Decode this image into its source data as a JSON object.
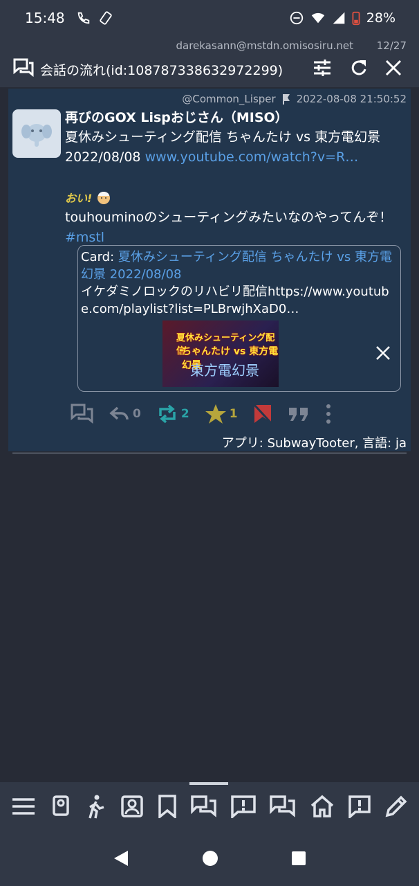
{
  "status_bar": {
    "time": "15:48",
    "battery": "28%"
  },
  "column_header": {
    "account": "darekasann@mstdn.omisosiru.net",
    "position": "12/27",
    "title": "会話の流れ(id:108787338632972299)"
  },
  "post": {
    "acct": "@Common_Lisper",
    "timestamp": "2022-08-08 21:50:52",
    "display_name": "再びのGOX Lispおじさん（MISO）",
    "text_line1": "夏休みシューティング配信 ちゃんたけ vs 東方電幻景 2022/08/08",
    "link": "www.youtube.com/watch?v=R…",
    "emoji_text": "おい!",
    "text_line2": "touhouminoのシューティングみたいなのやってんぞ！",
    "hashtag": "#mstl",
    "card": {
      "label": "Card:",
      "title": "夏休みシューティング配信 ちゃんたけ vs 東方電幻景 2022/08/08",
      "description": "イケダミノロックのリハビリ配信https://www.youtube.com/playlist?list=PLBrwjhXaD0…",
      "thumb_line1": "夏休みシューティング配信",
      "thumb_line2": "ちゃんたけ vs 東方電幻景",
      "thumb_line3": "東方電幻景"
    },
    "actions": {
      "reply_count": "0",
      "boost_count": "2",
      "favourite_count": "1"
    },
    "app_line": "アプリ: SubwayTooter, 言語: ja"
  },
  "colors": {
    "boost": "#2aa4a8",
    "favourite": "#b7a63c",
    "bookmark": "#c23a3a",
    "link": "#5aa0e6"
  }
}
